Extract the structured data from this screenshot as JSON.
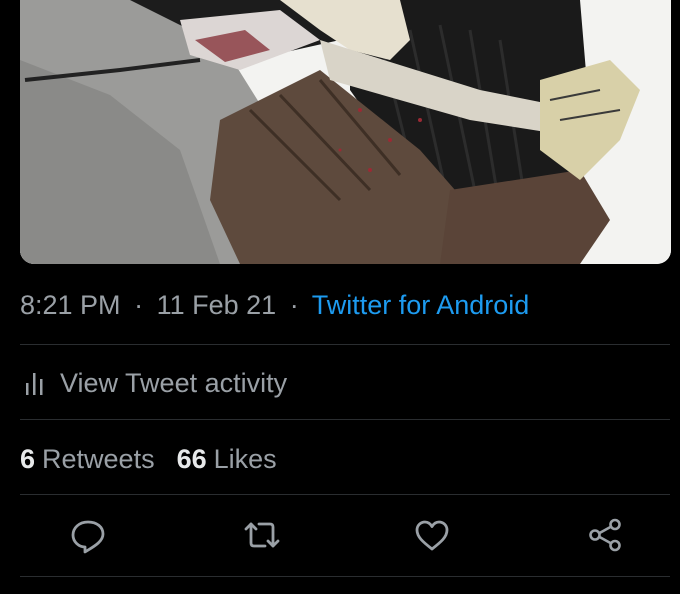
{
  "tweet": {
    "time": "8:21 PM",
    "date": "11 Feb 21",
    "separator": "·",
    "source": "Twitter for Android"
  },
  "activity": {
    "icon": "bar-chart-icon",
    "label": "View Tweet activity"
  },
  "stats": {
    "retweets_count": "6",
    "retweets_label": "Retweets",
    "likes_count": "66",
    "likes_label": "Likes"
  },
  "actions": {
    "reply_icon": "reply-icon",
    "retweet_icon": "retweet-icon",
    "like_icon": "heart-icon",
    "share_icon": "share-icon"
  },
  "colors": {
    "background": "#000000",
    "link": "#1d9bf0",
    "muted_text": "#9aa0a6",
    "divider": "#2a2d30"
  }
}
